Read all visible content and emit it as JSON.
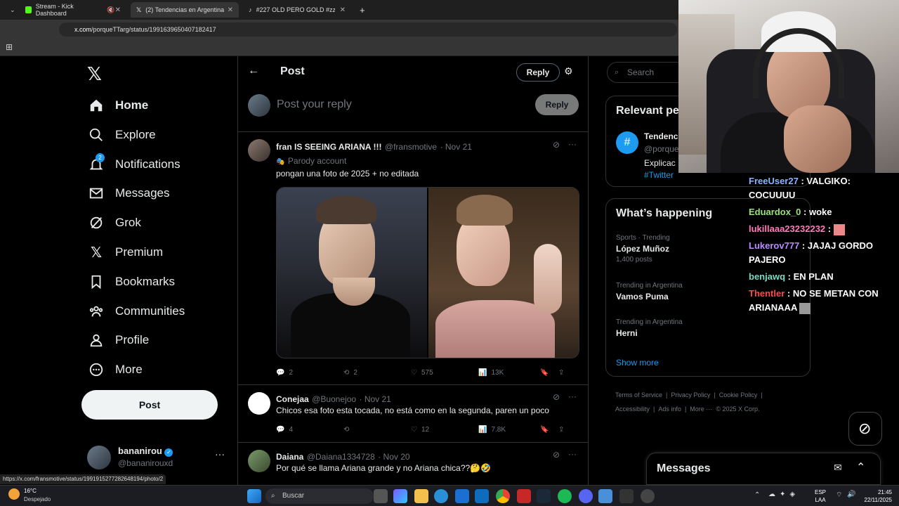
{
  "browser": {
    "tabs": [
      {
        "title": "Stream - Kick Dashboard"
      },
      {
        "title": "(2) Tendencias en Argentina en"
      },
      {
        "title": "#227 OLD PERO GOLD #zzk #z"
      }
    ],
    "url_domain": "x.com",
    "url_path": "/porqueTTarg/status/1991639650407182417",
    "status_url": "https://x.com/fransmotive/status/1991915277282648194/photo/2"
  },
  "nav": {
    "items": [
      {
        "label": "Home"
      },
      {
        "label": "Explore"
      },
      {
        "label": "Notifications",
        "badge": "2"
      },
      {
        "label": "Messages"
      },
      {
        "label": "Grok"
      },
      {
        "label": "Premium"
      },
      {
        "label": "Bookmarks"
      },
      {
        "label": "Communities"
      },
      {
        "label": "Profile"
      },
      {
        "label": "More"
      }
    ],
    "post_label": "Post",
    "account": {
      "name": "bananirou",
      "handle": "@bananirouxd"
    }
  },
  "header": {
    "title": "Post",
    "reply_label": "Reply"
  },
  "compose": {
    "placeholder": "Post your reply",
    "reply_label": "Reply"
  },
  "tweets": [
    {
      "name": "fran IS SEEING ARIANA !!!",
      "handle": "@fransmotive",
      "date": "· Nov 21",
      "label": "Parody account",
      "text": "pongan una foto de 2025 + no editada",
      "replies": "2",
      "reposts": "2",
      "likes": "575",
      "views": "13K"
    },
    {
      "name": "Conejaa",
      "handle": "@Buonejoo",
      "date": "· Nov 21",
      "text": "Chicos esa foto esta tocada, no está como en la segunda, paren un poco",
      "replies": "4",
      "reposts": "",
      "likes": "12",
      "views": "7.8K"
    },
    {
      "name": "Daiana",
      "handle": "@Daiana1334728",
      "date": "· Nov 20",
      "text": "Por qué se llama Ariana grande y no Ariana chica??🤔🤣"
    }
  ],
  "sidebar": {
    "search_placeholder": "Search",
    "relevant_title": "Relevant pe",
    "relevant": {
      "name": "Tendenc",
      "handle": "@porque",
      "text": "Explicac",
      "tag": "#Twitter"
    },
    "happening_title": "What’s happening",
    "trends": [
      {
        "category": "Sports · Trending",
        "name": "López Muñoz",
        "count": "1,400 posts"
      },
      {
        "category": "Trending in Argentina",
        "name": "Vamos Puma",
        "count": ""
      },
      {
        "category": "Trending in Argentina",
        "name": "Herni",
        "count": ""
      }
    ],
    "show_more": "Show more",
    "footer": [
      "Terms of Service",
      "|",
      "Privacy Policy",
      "|",
      "Cookie Policy",
      "|",
      "Accessibility",
      "|",
      "Ads info",
      "|",
      "More ···",
      "© 2025 X Corp."
    ],
    "messages_title": "Messages"
  },
  "chat": [
    {
      "user": "FreeUser27",
      "color": "#8ab4ff",
      "text": ": VALGIKO: COCUUUU"
    },
    {
      "user": "Eduardox_0",
      "color": "#9be37a",
      "text": ": woke"
    },
    {
      "user": "lukillaaa23232232",
      "color": "#ff7ab8",
      "text": ":"
    },
    {
      "user": "Lukerov777",
      "color": "#b98cff",
      "text": ": JAJAJ GORDO PAJERO"
    },
    {
      "user": "benjawq",
      "color": "#7ad9c0",
      "text": ": EN PLAN"
    },
    {
      "user": "Thentler",
      "color": "#ff4a4a",
      "text": ": NO SE METAN CON ARIANAAA"
    }
  ],
  "taskbar": {
    "weather_temp": "16°C",
    "weather_desc": "Despejado",
    "search_label": "Buscar",
    "lang_top": "ESP",
    "lang_bottom": "LAA",
    "time": "21:45",
    "date": "22/11/2025"
  }
}
